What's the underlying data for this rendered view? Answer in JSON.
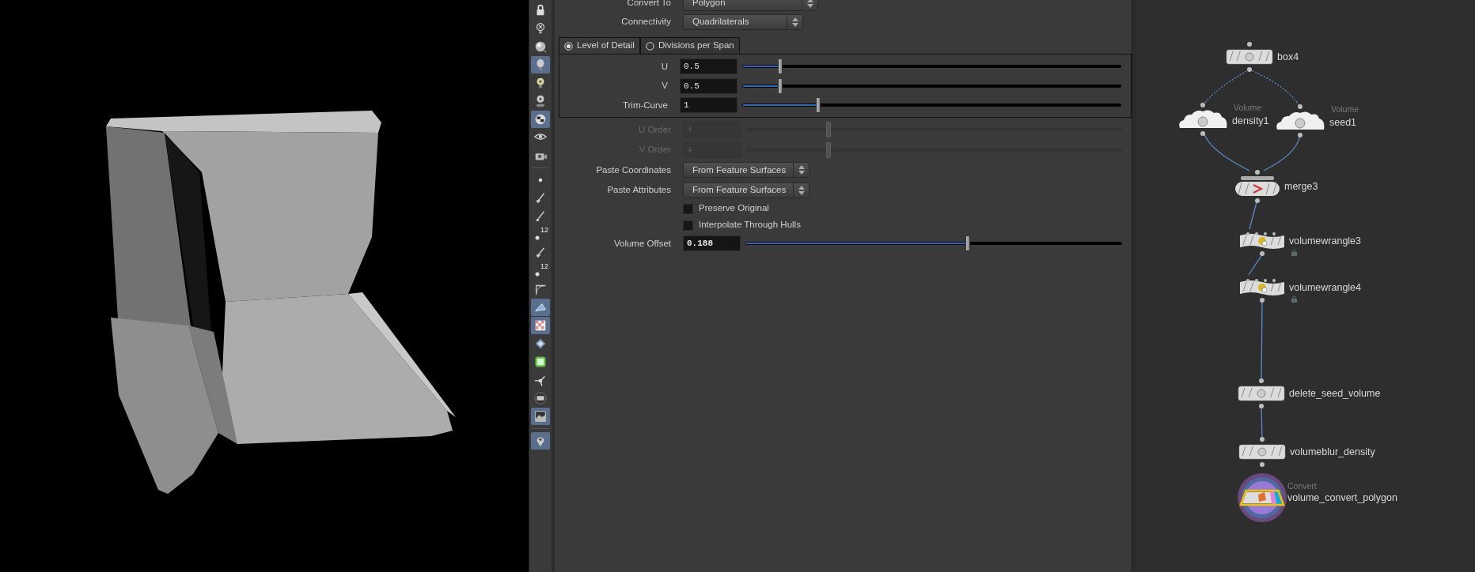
{
  "toolbar": [
    {
      "kind": "lock",
      "selected": false
    },
    {
      "kind": "bulb-cross",
      "selected": false
    },
    {
      "kind": "sphere",
      "selected": false
    },
    {
      "kind": "bulb",
      "selected": true
    },
    {
      "kind": "bulb-yellow",
      "selected": false
    },
    {
      "kind": "bulb-pin",
      "selected": false
    },
    {
      "kind": "checker-sphere",
      "selected": true
    },
    {
      "kind": "eye",
      "selected": false
    },
    {
      "kind": "camera",
      "selected": false
    },
    {
      "kind": "separator"
    },
    {
      "kind": "dot",
      "selected": false
    },
    {
      "kind": "brush",
      "selected": false
    },
    {
      "kind": "pin",
      "selected": false
    },
    {
      "kind": "numbers",
      "badge": "12",
      "selected": false
    },
    {
      "kind": "brush",
      "selected": false
    },
    {
      "kind": "numbers",
      "badge": "12",
      "selected": false
    },
    {
      "kind": "curve",
      "selected": false
    },
    {
      "kind": "triangle",
      "selected": true
    },
    {
      "kind": "checker",
      "selected": true
    },
    {
      "kind": "diamond",
      "selected": false
    },
    {
      "kind": "green-square",
      "selected": false
    },
    {
      "kind": "axes",
      "selected": false
    },
    {
      "kind": "circle-bar",
      "selected": false
    },
    {
      "kind": "frame",
      "selected": true
    },
    {
      "kind": "separator"
    },
    {
      "kind": "map-pin",
      "selected": true
    }
  ],
  "parameters": [
    {
      "kind": "menu",
      "label": "Convert To",
      "value": "Polygon"
    },
    {
      "kind": "menu",
      "label": "Connectivity",
      "value": "Quadrilaterals"
    },
    {
      "kind": "tabs",
      "tabs": [
        {
          "label": "Level of Detail",
          "selected": true
        },
        {
          "label": "Divisions per Span",
          "selected": false
        }
      ],
      "params": [
        {
          "kind": "slider",
          "label": "U",
          "value": "0.5",
          "level": 0.1,
          "disabled": false,
          "changed": false
        },
        {
          "kind": "slider",
          "label": "V",
          "value": "0.5",
          "level": 0.1,
          "disabled": false,
          "changed": false
        },
        {
          "kind": "slider",
          "label": "Trim-Curve",
          "value": "1",
          "level": 0.2,
          "disabled": false,
          "changed": false
        }
      ]
    },
    {
      "kind": "slider",
      "label": "U Order",
      "value": "4",
      "level": 0.22,
      "disabled": true,
      "changed": false
    },
    {
      "kind": "slider",
      "label": "V Order",
      "value": "4",
      "level": 0.22,
      "disabled": true,
      "changed": false
    },
    {
      "kind": "menu",
      "label": "Paste Coordinates",
      "value": "From Feature Surfaces"
    },
    {
      "kind": "menu",
      "label": "Paste Attributes",
      "value": "From Feature Surfaces"
    },
    {
      "kind": "checkbox",
      "label": "Preserve Original",
      "checked": false
    },
    {
      "kind": "checkbox",
      "label": "Interpolate Through Hulls",
      "checked": false
    },
    {
      "kind": "slider",
      "label": "Volume Offset",
      "value": "0.188",
      "level": 0.59,
      "disabled": false,
      "changed": true
    }
  ],
  "network": {
    "nodes": [
      {
        "kind": "box",
        "name": "box4",
        "locked": false,
        "selected": false,
        "display_flag": false
      },
      {
        "kind": "cloud",
        "subtitle": "Volume",
        "name": "density1",
        "locked": false,
        "selected": false,
        "display_flag": false
      },
      {
        "kind": "cloud",
        "subtitle": "Volume",
        "name": "seed1",
        "locked": false,
        "selected": false,
        "display_flag": false
      },
      {
        "kind": "merge",
        "name": "merge3",
        "locked": false,
        "selected": false,
        "display_flag": false
      },
      {
        "kind": "wrangle",
        "name": "volumewrangle3",
        "locked": true,
        "selected": false,
        "display_flag": false
      },
      {
        "kind": "wrangle",
        "name": "volumewrangle4",
        "locked": true,
        "selected": false,
        "display_flag": false
      },
      {
        "kind": "box",
        "name": "delete_seed_volume",
        "locked": false,
        "selected": false,
        "display_flag": false
      },
      {
        "kind": "box",
        "name": "volumeblur_density",
        "locked": false,
        "selected": false,
        "display_flag": false
      },
      {
        "kind": "convert",
        "subtitle": "Convert",
        "name": "volume_convert_polygon",
        "locked": false,
        "selected": true,
        "display_flag": true
      }
    ]
  }
}
